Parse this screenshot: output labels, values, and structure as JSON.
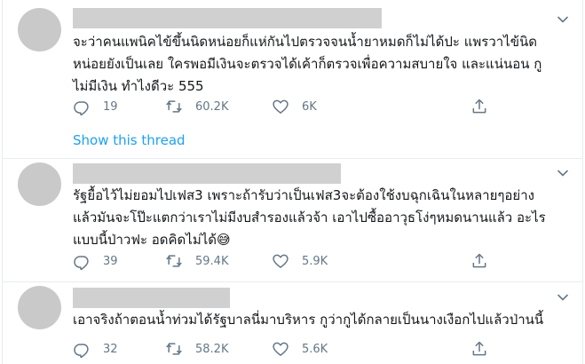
{
  "tweets": [
    {
      "lines": [
        "จะว่าคนแพนิคไข้ขึ้นนิดหน่อยก็แห่กันไปตรวจจนน้ำยาหมดก็ไม่ได้ปะ  แพรวาไข้นิด",
        "หน่อยยังเป็นเลย ใครพอมีเงินจะตรวจได้เค้าก็ตรวจเพื่อความสบายใจ และแน่นอน กู",
        "ไม่มีเงิน ทำไงดีวะ 555"
      ],
      "replies": "19",
      "retweets": "60.2K",
      "likes": "6K",
      "show_thread": "Show this thread"
    },
    {
      "lines": [
        "รัฐยื้อไว้ไม่ยอมไปเฟส3 เพราะถ้ารับว่าเป็นเฟส3จะต้องใช้งบฉุกเฉินในหลายๆอย่าง",
        "แล้วมันจะโป๊ะแตกว่าเราไม่มีงบสำรองแล้วจ้า เอาไปซื้ออาวุธโง่ๆหมดนานแล้ว อะไร",
        "แบบนี้ป่าวฟะ อดคิดไม่ได้"
      ],
      "emoji": "😅",
      "replies": "39",
      "retweets": "59.4K",
      "likes": "5.9K"
    },
    {
      "lines": [
        "เอาจริงถ้าตอนน้ำท่วมได้รัฐบาลนี่มาบริหาร กูว่ากูได้กลายเป็นนางเงือกไปแล้วป่านนี้"
      ],
      "replies": "32",
      "retweets": "58.2K",
      "likes": "5.6K"
    }
  ],
  "colors": {
    "text": "#14171a",
    "muted": "#657786",
    "link": "#1da1f2",
    "placeholder": "#c9c9c9"
  }
}
